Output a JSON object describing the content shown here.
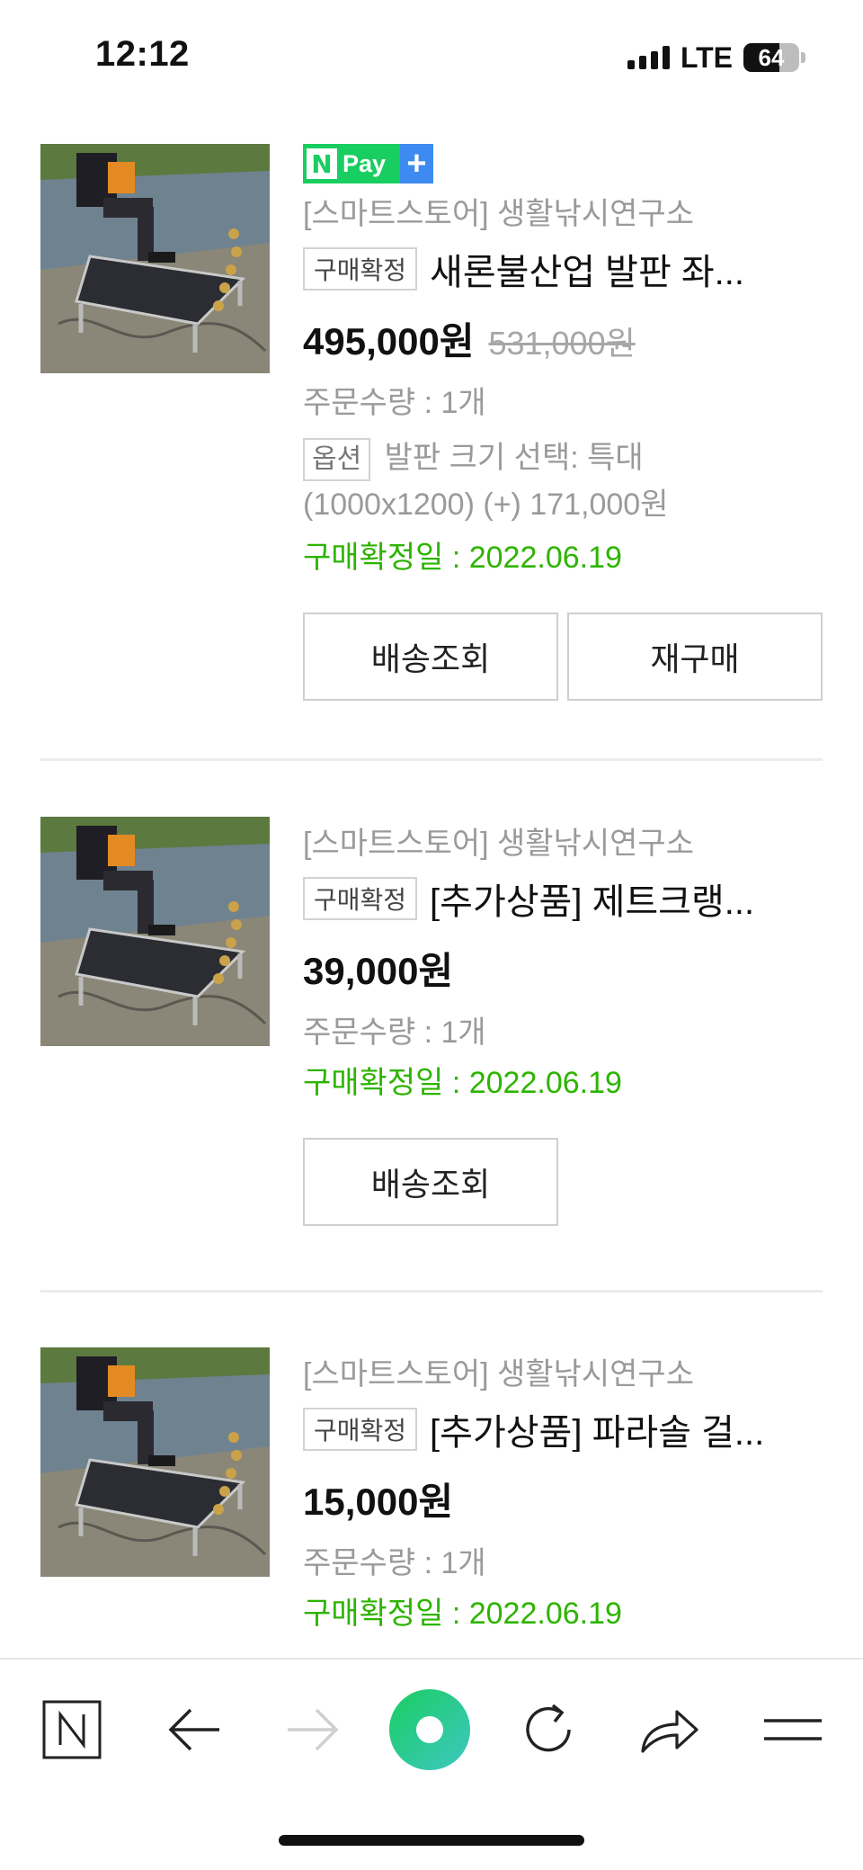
{
  "status_bar": {
    "time": "12:12",
    "network": "LTE",
    "battery": "64",
    "battery_level": 0.64
  },
  "orders": [
    {
      "npay_badge": {
        "n": "N",
        "pay": "Pay",
        "plus": "+"
      },
      "store": "[스마트스토어] 생활낚시연구소",
      "status_tag": "구매확정",
      "product_name": "새론불산업 발판 좌...",
      "price": "495,000원",
      "original_price": "531,000원",
      "quantity": "주문수량 : 1개",
      "option_tag": "옵션",
      "option_line1": "발판 크기 선택: 특대",
      "option_line2": "(1000x1200) (+) 171,000원",
      "confirm_date": "구매확정일 : 2022.06.19",
      "buttons": [
        "배송조회",
        "재구매"
      ]
    },
    {
      "store": "[스마트스토어] 생활낚시연구소",
      "status_tag": "구매확정",
      "product_name": "[추가상품] 제트크랭...",
      "price": "39,000원",
      "quantity": "주문수량 : 1개",
      "confirm_date": "구매확정일 : 2022.06.19",
      "buttons": [
        "배송조회"
      ]
    },
    {
      "store": "[스마트스토어] 생활낚시연구소",
      "status_tag": "구매확정",
      "product_name": "[추가상품] 파라솔 걸...",
      "price": "15,000원",
      "quantity": "주문수량 : 1개",
      "confirm_date": "구매확정일 : 2022.06.19"
    }
  ],
  "toolbar": {
    "items": [
      "naver-home-icon",
      "back-arrow-icon",
      "forward-arrow-icon",
      "green-dot-icon",
      "reload-icon",
      "share-icon",
      "menu-icon"
    ]
  },
  "colors": {
    "npay_green": "#19ce60",
    "npay_blue": "#3d8bf0",
    "confirm_green": "#2db400",
    "text_gray": "#9a9a9a"
  }
}
